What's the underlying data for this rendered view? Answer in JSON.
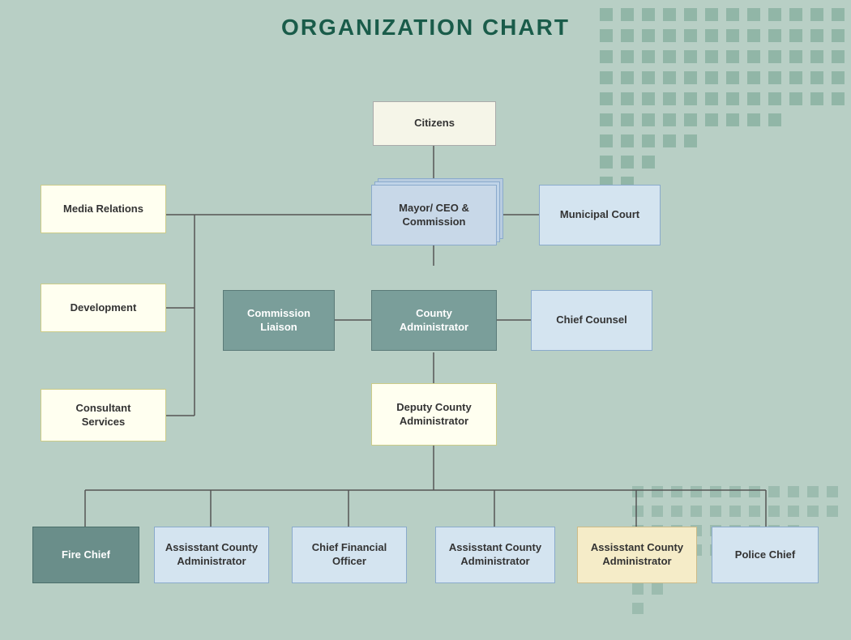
{
  "title": "ORGANIZATION CHART",
  "nodes": {
    "citizens": {
      "label": "Citizens"
    },
    "mayor": {
      "label": "Mayor/\nCEO & Commission"
    },
    "municipal_court": {
      "label": "Municipal Court"
    },
    "media_relations": {
      "label": "Media Relations"
    },
    "development": {
      "label": "Development"
    },
    "consultant_services": {
      "label": "Consultant\nServices"
    },
    "commission_liaison": {
      "label": "Commission\nLiaison"
    },
    "county_administrator": {
      "label": "County\nAdministrator"
    },
    "chief_counsel": {
      "label": "Chief Counsel"
    },
    "deputy_county_admin": {
      "label": "Deputy County\nAdministrator"
    },
    "fire_chief": {
      "label": "Fire Chief"
    },
    "asst_county_admin1": {
      "label": "Assisstant County\nAdministrator"
    },
    "chief_financial_officer": {
      "label": "Chief Financial\nOfficer"
    },
    "asst_county_admin2": {
      "label": "Assisstant County\nAdministrator"
    },
    "asst_county_admin3": {
      "label": "Assisstant County\nAdministrator"
    },
    "police_chief": {
      "label": "Police Chief"
    }
  },
  "colors": {
    "background": "#b8cfc5",
    "title": "#1a5c4a",
    "node_yellow": "#fffff0",
    "node_blue": "#c8d8e8",
    "node_teal": "#7a9e9a"
  }
}
